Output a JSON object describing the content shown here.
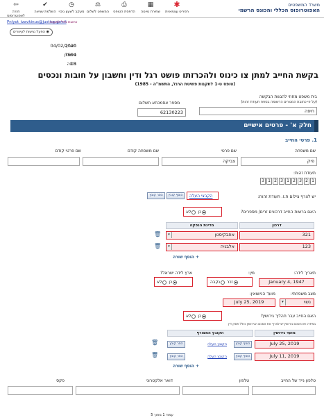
{
  "org": {
    "line1": "משרד המשפטים",
    "line2": "האפוטרופוס הכללי והכונס הרשמי"
  },
  "toolbar": [
    {
      "label": "תפריט עצמאיות",
      "icon": "star-icon"
    },
    {
      "label": "שמירת טיוטה",
      "icon": "save-icon"
    },
    {
      "label": "הדפסת הטופס",
      "icon": "print-icon"
    },
    {
      "label": "המשפט לשלום",
      "icon": "scale-icon"
    },
    {
      "label": "מעקב לשעון גיבוי",
      "icon": "clock-icon"
    },
    {
      "label": "השלמת שגיאה",
      "icon": "check-icon"
    },
    {
      "label": "חזרה לאפוטרופוס",
      "icon": "exit-icon"
    }
  ],
  "email_label": "כתובת מייל למענה:",
  "email": "Pnlyot_tzavkinus@justice.gov.il",
  "accessibility_btn": "הפעל נגישות לעיוורים",
  "meta": [
    {
      "label": "תאריך",
      "value": "04/02/2020"
    },
    {
      "label": "סימוכין",
      "value": "7594"
    },
    {
      "label": "גרסה",
      "value": "18"
    }
  ],
  "title": "בקשת החייב למתן צו כינוס ולהכרזתו פושט רגל ודין וחשבון על חובות ונכסים",
  "subtitle": "(טופס ט-1 לתקנות פשיטת הרגל, התשמ\"ה - 1985)",
  "court_label": "בית משפט מחוזי להגשת הבקשה",
  "court_hint": "(על פי כתובת המגורים הרשומה בספח תעודת זהות)",
  "court_value": "חיפה",
  "fee_label": "מספר אסמכתא תשלום",
  "fee_value": "62130223",
  "section_a": "חלק א' - פרטים אישיים",
  "section_a_sub": "1. פרטי החייב",
  "name_labels": {
    "last": "שם משפחה",
    "first": "שם פרטי",
    "prev_last": "שם משפחה קודם",
    "prev_first": "שם פרטי קודם"
  },
  "name_values": {
    "last": "פיק",
    "first": "צביקה",
    "prev_last": "",
    "prev_first": ""
  },
  "id_label": "תעודת זהות:",
  "id_digits": [
    "1",
    "2",
    "3",
    "2",
    "1",
    "3",
    "2",
    "1",
    "3"
  ],
  "id_attach_label": "יש לצרף צילום ת.ז. תעודת זהות:",
  "upload_btn": "הקבצי העלה",
  "attach_btn": "הוסף קובץ",
  "remove_btn": "הסר קובץ",
  "foreign_q": "האם ברשות החייב דרכונים זרים/ מספרים?",
  "yes": "כן",
  "no": "לא",
  "passport_head": {
    "num": "דרכון",
    "country": "מדינת הנפקה"
  },
  "passports": [
    {
      "num": "321",
      "country": "אוזבקיסטן"
    },
    {
      "num": "123",
      "country": "אלבניה"
    }
  ],
  "add_row": "+ הוסף שורה",
  "birth_label": "תאריך לידה:",
  "birth_value": "January 4, 1947",
  "gender_label": "מין:",
  "male": "זכר",
  "female": "נקבה",
  "born_il_label": "ארץ לידה ישראל?",
  "marital_label": "מצב משפחתי:",
  "marital_value": "נשוי",
  "wedding_label": "מועד הנישואין:",
  "wedding_value": "July 25, 2019",
  "divorced_q": "האם החייב עבר תהליך גירושין?",
  "divorced_hint": "במידה ויש הסכם גירושין יש לצרף את הסכם הגירושין כולל פסק דין",
  "div_head": {
    "date": "מועד גירושין",
    "file": "הקובץ המצורף"
  },
  "divorces": [
    {
      "date": "July 25, 2019",
      "attach": "הוסף קובץ",
      "upload": "הקובץ העלה",
      "remove": "הסר קובץ"
    },
    {
      "date": "July 11, 2019",
      "attach": "הוסף קובץ",
      "upload": "הקובץ העלה",
      "remove": "הסר קובץ"
    }
  ],
  "contacts": {
    "mobile": "טלפון נייד של החייב",
    "phone": "טלפון",
    "email": "דואר אלקטרוני",
    "fax": "פקס"
  },
  "footer": "עמוד 1 מתוך 5",
  "accent": "#2f5d8c",
  "error_color": "#d9232e"
}
